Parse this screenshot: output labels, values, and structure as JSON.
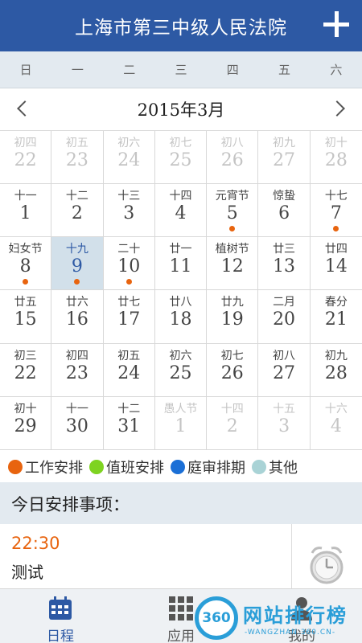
{
  "header": {
    "title": "上海市第三中级人民法院",
    "add_icon": "plus-icon"
  },
  "weekdays": [
    "日",
    "一",
    "二",
    "三",
    "四",
    "五",
    "六"
  ],
  "calendar": {
    "month_label": "2015年3月",
    "prev_icon": "chevron-left-icon",
    "next_icon": "chevron-right-icon",
    "cells": [
      {
        "lunar": "初四",
        "day": "22",
        "muted": true
      },
      {
        "lunar": "初五",
        "day": "23",
        "muted": true
      },
      {
        "lunar": "初六",
        "day": "24",
        "muted": true
      },
      {
        "lunar": "初七",
        "day": "25",
        "muted": true
      },
      {
        "lunar": "初八",
        "day": "26",
        "muted": true
      },
      {
        "lunar": "初九",
        "day": "27",
        "muted": true
      },
      {
        "lunar": "初十",
        "day": "28",
        "muted": true
      },
      {
        "lunar": "十一",
        "day": "1"
      },
      {
        "lunar": "十二",
        "day": "2"
      },
      {
        "lunar": "十三",
        "day": "3"
      },
      {
        "lunar": "十四",
        "day": "4"
      },
      {
        "lunar": "元宵节",
        "day": "5",
        "dot": "#e8640f"
      },
      {
        "lunar": "惊蛰",
        "day": "6"
      },
      {
        "lunar": "十七",
        "day": "7",
        "dot": "#e8640f"
      },
      {
        "lunar": "妇女节",
        "day": "8",
        "dot": "#e8640f"
      },
      {
        "lunar": "十九",
        "day": "9",
        "dot": "#e8640f",
        "today": true
      },
      {
        "lunar": "二十",
        "day": "10",
        "dot": "#e8640f"
      },
      {
        "lunar": "廿一",
        "day": "11"
      },
      {
        "lunar": "植树节",
        "day": "12"
      },
      {
        "lunar": "廿三",
        "day": "13"
      },
      {
        "lunar": "廿四",
        "day": "14"
      },
      {
        "lunar": "廿五",
        "day": "15"
      },
      {
        "lunar": "廿六",
        "day": "16"
      },
      {
        "lunar": "廿七",
        "day": "17"
      },
      {
        "lunar": "廿八",
        "day": "18"
      },
      {
        "lunar": "廿九",
        "day": "19"
      },
      {
        "lunar": "二月",
        "day": "20"
      },
      {
        "lunar": "春分",
        "day": "21"
      },
      {
        "lunar": "初三",
        "day": "22"
      },
      {
        "lunar": "初四",
        "day": "23"
      },
      {
        "lunar": "初五",
        "day": "24"
      },
      {
        "lunar": "初六",
        "day": "25"
      },
      {
        "lunar": "初七",
        "day": "26"
      },
      {
        "lunar": "初八",
        "day": "27"
      },
      {
        "lunar": "初九",
        "day": "28"
      },
      {
        "lunar": "初十",
        "day": "29"
      },
      {
        "lunar": "十一",
        "day": "30"
      },
      {
        "lunar": "十二",
        "day": "31"
      },
      {
        "lunar": "愚人节",
        "day": "1",
        "muted": true
      },
      {
        "lunar": "十四",
        "day": "2",
        "muted": true
      },
      {
        "lunar": "十五",
        "day": "3",
        "muted": true
      },
      {
        "lunar": "十六",
        "day": "4",
        "muted": true
      }
    ]
  },
  "legend": [
    {
      "label": "工作安排",
      "color": "#e8640f"
    },
    {
      "label": "值班安排",
      "color": "#7ed321"
    },
    {
      "label": "庭审排期",
      "color": "#1b6fd6"
    },
    {
      "label": "其他",
      "color": "#a9d3d6"
    }
  ],
  "agenda": {
    "title": "今日安排事项：",
    "event": {
      "time": "22:30",
      "name": "测试",
      "icon": "alarm-clock-icon"
    }
  },
  "tabs": [
    {
      "label": "日程",
      "icon": "calendar-icon",
      "active": true
    },
    {
      "label": "应用",
      "icon": "grid-icon"
    },
    {
      "label": "我的",
      "icon": "person-icon"
    }
  ],
  "watermark": {
    "badge": "360",
    "text": "网站排行榜",
    "sub": "-WANGZHAN.360.CN-"
  },
  "colors": {
    "primary": "#2d59a4",
    "today_bg": "#d2e0ea",
    "accent": "#e8640f"
  }
}
